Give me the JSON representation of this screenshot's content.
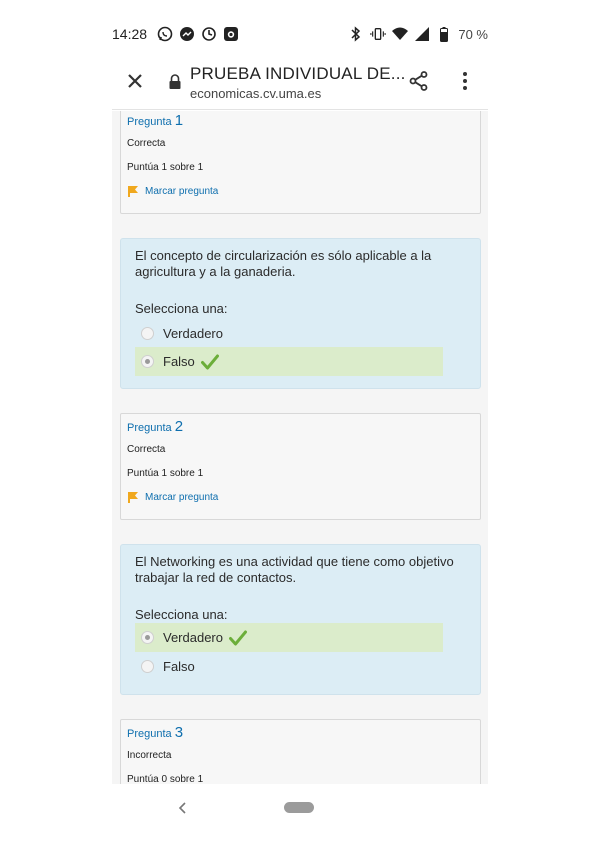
{
  "status_bar": {
    "time": "14:28",
    "battery": "70 %",
    "left_icons": [
      "whatsapp-icon",
      "messenger-icon",
      "sync-icon",
      "camera-icon"
    ],
    "right_icons": [
      "bluetooth-icon",
      "vibrate-icon",
      "wifi-icon",
      "signal-icon",
      "battery-icon"
    ]
  },
  "browser": {
    "title": "PRUEBA INDIVIDUAL DE...",
    "url": "economicas.cv.uma.es"
  },
  "questions": [
    {
      "label": "Pregunta",
      "number": "1",
      "state": "Correcta",
      "grade": "Puntúa 1 sobre 1",
      "flag": "Marcar pregunta",
      "text": "El concepto de circularización es sólo aplicable a la agricultura y a la ganaderia.",
      "prompt": "Selecciona una:",
      "options": [
        "Verdadero",
        "Falso"
      ],
      "selected": "Falso"
    },
    {
      "label": "Pregunta",
      "number": "2",
      "state": "Correcta",
      "grade": "Puntúa 1 sobre 1",
      "flag": "Marcar pregunta",
      "text": "El Networking es una actividad que tiene como objetivo trabajar la red de contactos.",
      "prompt": "Selecciona una:",
      "options": [
        "Verdadero",
        "Falso"
      ],
      "selected": "Verdadero"
    },
    {
      "label": "Pregunta",
      "number": "3",
      "state": "Incorrecta",
      "grade": "Puntúa 0 sobre 1"
    }
  ],
  "colors": {
    "link_blue": "#0f6fae",
    "question_bg": "#dcedf5",
    "correct_bg": "#dbeccb",
    "check_green": "#6cae3a",
    "flag_orange": "#f0a81e"
  }
}
